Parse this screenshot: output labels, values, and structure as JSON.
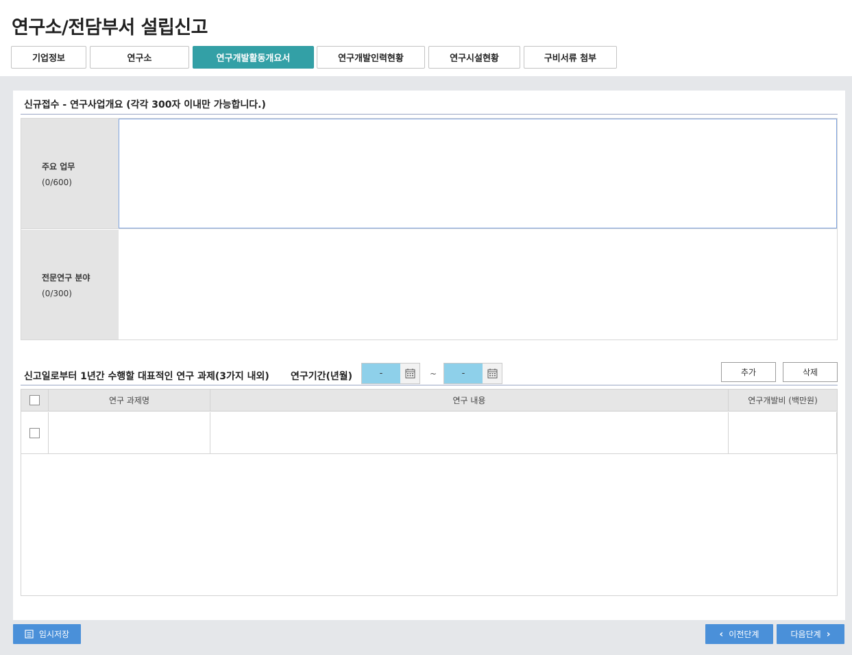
{
  "page": {
    "title": "연구소/전담부서 설립신고"
  },
  "tabs": [
    {
      "label": "기업정보"
    },
    {
      "label": "연구소"
    },
    {
      "label": "연구개발활동개요서"
    },
    {
      "label": "연구개발인력현황"
    },
    {
      "label": "연구시설현황"
    },
    {
      "label": "구비서류 첨부"
    }
  ],
  "active_tab": "연구개발활동개요서",
  "section1": {
    "title": "신규접수 - 연구사업개요 (각각 300자 이내만 가능합니다.)",
    "fields": [
      {
        "label": "주요 업무",
        "count": "(0/600)",
        "value": ""
      },
      {
        "label": "전문연구 분야",
        "count": "(0/300)",
        "value": ""
      }
    ]
  },
  "section2": {
    "title": "신고일로부터 1년간 수행할 대표적인 연구 과제(3가지 내외)",
    "period_label": "연구기간(년월)",
    "start_value": "-",
    "end_value": "-",
    "tilde": "~",
    "add_button": "추가",
    "delete_button": "삭제",
    "columns": [
      "연구 과제명",
      "연구 내용",
      "연구개발비 (백만원)"
    ]
  },
  "footer": {
    "save_button": "임시저장",
    "prev_button": "이전단계",
    "next_button": "다음단계"
  },
  "colors": {
    "accent": "#33a0a6",
    "button_blue": "#4a90d9",
    "date_fill": "#8ed0ea"
  }
}
